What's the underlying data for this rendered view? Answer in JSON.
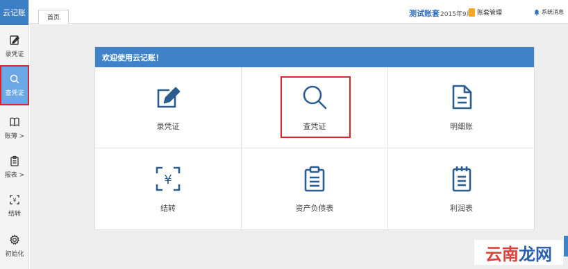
{
  "app": {
    "logo": "云记账"
  },
  "sidebar": {
    "items": [
      {
        "label": "录凭证",
        "icon": "edit-icon"
      },
      {
        "label": "查凭证",
        "icon": "search-icon",
        "active": true
      },
      {
        "label": "账薄 >",
        "icon": "book-icon"
      },
      {
        "label": "报表 >",
        "icon": "clipboard-icon"
      },
      {
        "label": "结转",
        "icon": "yen-transfer-icon"
      },
      {
        "label": "初始化",
        "icon": "gear-icon"
      }
    ]
  },
  "topbar": {
    "tab": "首页",
    "account_name": "测试账套",
    "period": "2015年9月",
    "book_management": "账套管理",
    "system_messages": "系统消息"
  },
  "panel": {
    "title": "欢迎使用云记账！",
    "cells": [
      {
        "label": "录凭证",
        "icon": "edit-icon"
      },
      {
        "label": "查凭证",
        "icon": "search-icon",
        "highlighted": true
      },
      {
        "label": "明细账",
        "icon": "document-icon"
      },
      {
        "label": "结转",
        "icon": "yen-transfer-icon"
      },
      {
        "label": "资产负债表",
        "icon": "clipboard-icon"
      },
      {
        "label": "利润表",
        "icon": "notepad-icon"
      }
    ]
  },
  "watermark": {
    "part1": "云南",
    "part2": "龙网"
  },
  "colors": {
    "accent": "#3f82c8",
    "active": "#6aa9e6",
    "highlight": "#d9262c",
    "icon": "#2b5d91"
  }
}
